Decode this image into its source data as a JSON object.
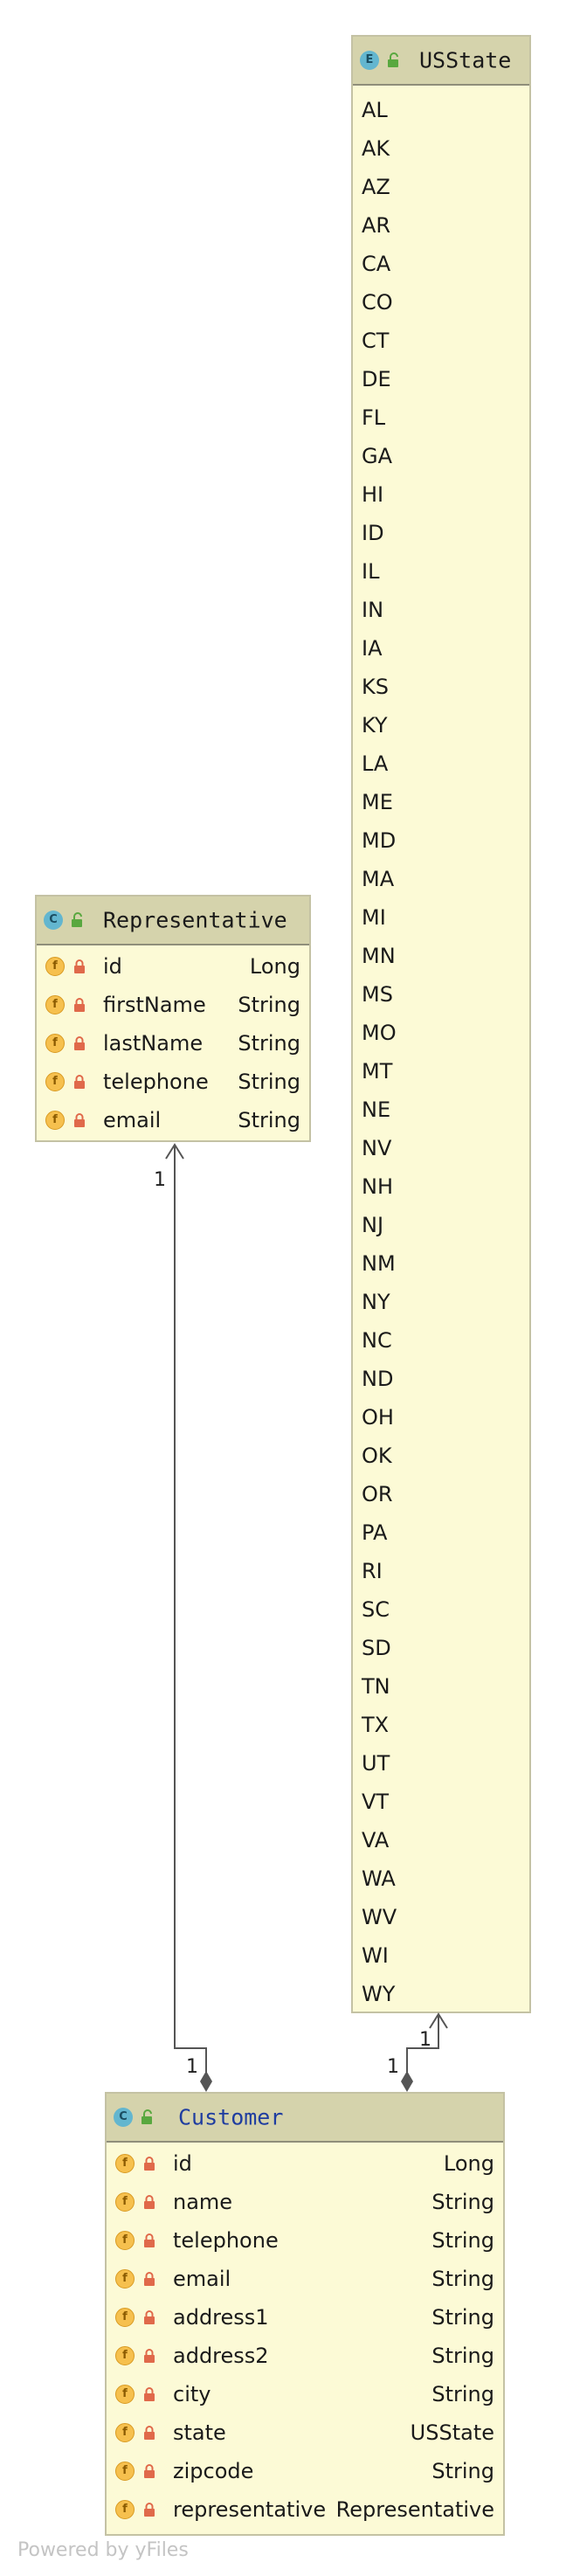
{
  "diagram": {
    "classes": {
      "usstate": {
        "name": "USState",
        "kind_letter": "E",
        "constants": [
          "AL",
          "AK",
          "AZ",
          "AR",
          "CA",
          "CO",
          "CT",
          "DE",
          "FL",
          "GA",
          "HI",
          "ID",
          "IL",
          "IN",
          "IA",
          "KS",
          "KY",
          "LA",
          "ME",
          "MD",
          "MA",
          "MI",
          "MN",
          "MS",
          "MO",
          "MT",
          "NE",
          "NV",
          "NH",
          "NJ",
          "NM",
          "NY",
          "NC",
          "ND",
          "OH",
          "OK",
          "OR",
          "PA",
          "RI",
          "SC",
          "SD",
          "TN",
          "TX",
          "UT",
          "VT",
          "VA",
          "WA",
          "WV",
          "WI",
          "WY"
        ]
      },
      "representative": {
        "name": "Representative",
        "kind_letter": "C",
        "fields": [
          {
            "badge": "f",
            "name": "id",
            "type": "Long"
          },
          {
            "badge": "f",
            "name": "firstName",
            "type": "String"
          },
          {
            "badge": "f",
            "name": "lastName",
            "type": "String"
          },
          {
            "badge": "f",
            "name": "telephone",
            "type": "String"
          },
          {
            "badge": "f",
            "name": "email",
            "type": "String"
          }
        ]
      },
      "customer": {
        "name": "Customer",
        "kind_letter": "C",
        "fields": [
          {
            "badge": "f",
            "name": "id",
            "type": "Long"
          },
          {
            "badge": "f",
            "name": "name",
            "type": "String"
          },
          {
            "badge": "f",
            "name": "telephone",
            "type": "String"
          },
          {
            "badge": "f",
            "name": "email",
            "type": "String"
          },
          {
            "badge": "f",
            "name": "address1",
            "type": "String"
          },
          {
            "badge": "f",
            "name": "address2",
            "type": "String"
          },
          {
            "badge": "f",
            "name": "city",
            "type": "String"
          },
          {
            "badge": "f",
            "name": "state",
            "type": "USState"
          },
          {
            "badge": "f",
            "name": "zipcode",
            "type": "String"
          },
          {
            "badge": "f",
            "name": "representative",
            "type": "Representative"
          }
        ]
      }
    },
    "relations": {
      "customer_representative": {
        "source_multiplicity": "1",
        "target_multiplicity": "1"
      },
      "customer_usstate": {
        "source_multiplicity": "1",
        "target_multiplicity": "1"
      }
    },
    "colors": {
      "box_fill": "#fcfad6",
      "header_fill": "#d5d3ac",
      "field_badge": "#f6c04e",
      "lock": "#e0694a",
      "class_badge": "#63b6cf",
      "title_blue": "#1f3da0"
    }
  },
  "footer": {
    "watermark": "Powered by yFiles"
  }
}
